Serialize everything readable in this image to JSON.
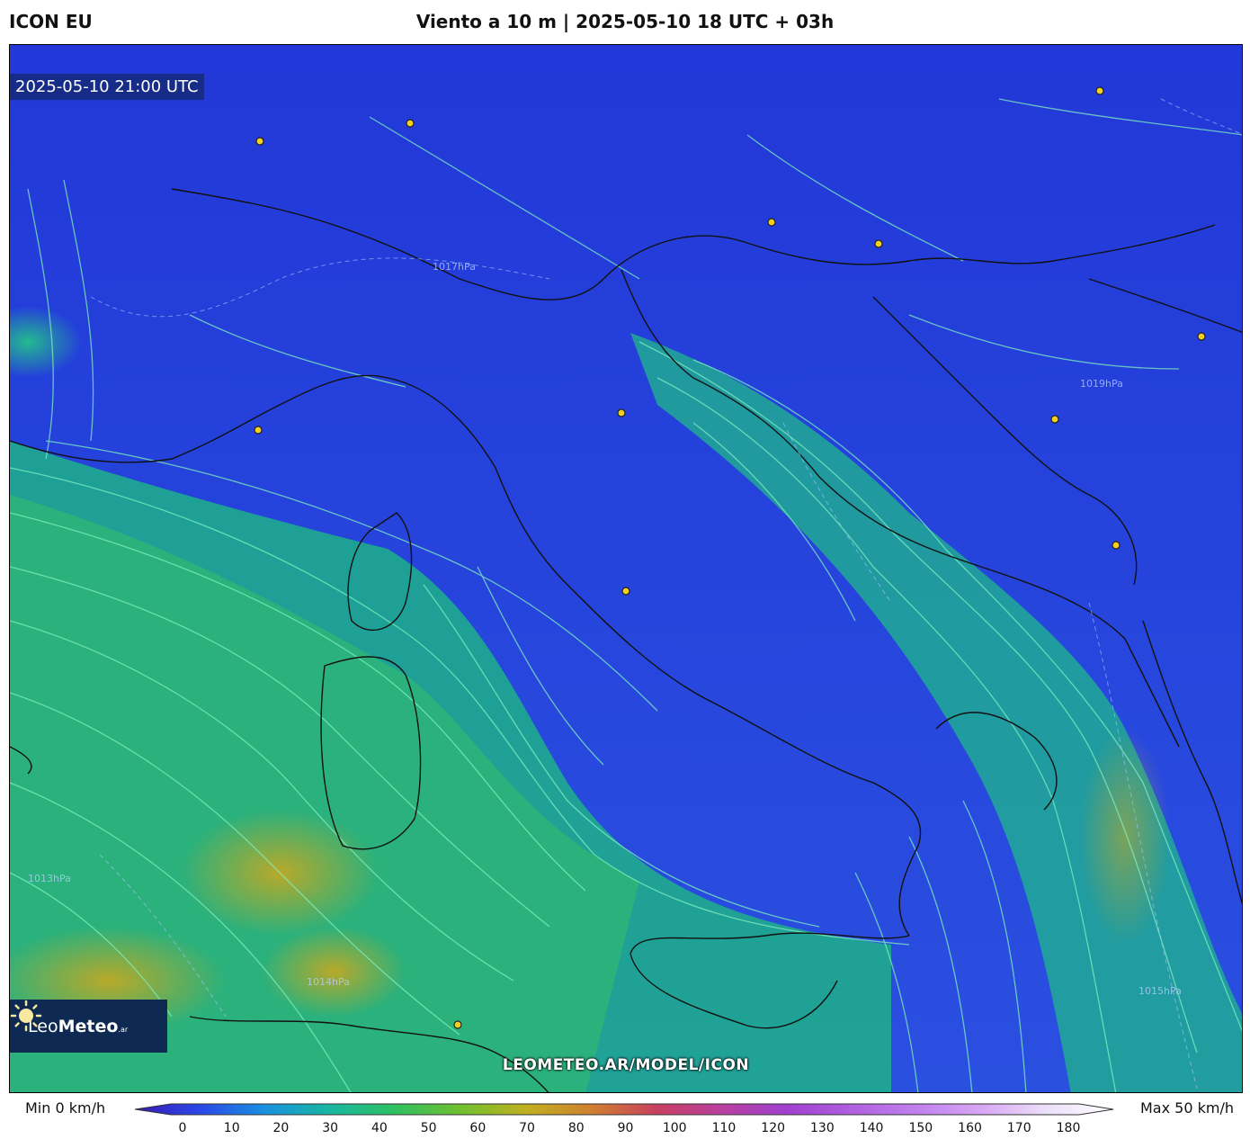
{
  "header": {
    "model": "ICON EU",
    "title": "Viento a 10 m | 2025-05-10 18 UTC + 03h"
  },
  "map": {
    "valid_time": "2025-05-10 21:00 UTC",
    "watermark": "LEOMETEO.AR/MODEL/ICON",
    "logo": {
      "prefix": "Leo",
      "bold": "Meteo",
      "suffix": ".ar"
    },
    "isobar_labels": [
      "1015hPa",
      "1017hPa",
      "1019hPa",
      "1013hPa",
      "1014hPa"
    ],
    "colors": {
      "calm": "#2030d8",
      "moderate": "#20b890",
      "strong": "#c8a020",
      "streamlines": "#7ff0c0",
      "city_marker": "#f5d020"
    }
  },
  "legend": {
    "min_label": "Min 0 km/h",
    "max_label": "Max 50 km/h",
    "ticks": [
      "0",
      "10",
      "20",
      "30",
      "40",
      "50",
      "60",
      "70",
      "80",
      "90",
      "100",
      "110",
      "120",
      "130",
      "140",
      "150",
      "160",
      "170",
      "180"
    ],
    "colors": [
      "#3a1ab0",
      "#2a48e8",
      "#1a90e0",
      "#18b8a0",
      "#30c060",
      "#70c030",
      "#c0b020",
      "#d08030",
      "#c84060",
      "#b840a0",
      "#a040d0",
      "#b060e0",
      "#c080ee",
      "#d8a8f4",
      "#ece0fa",
      "#ffffff"
    ]
  }
}
